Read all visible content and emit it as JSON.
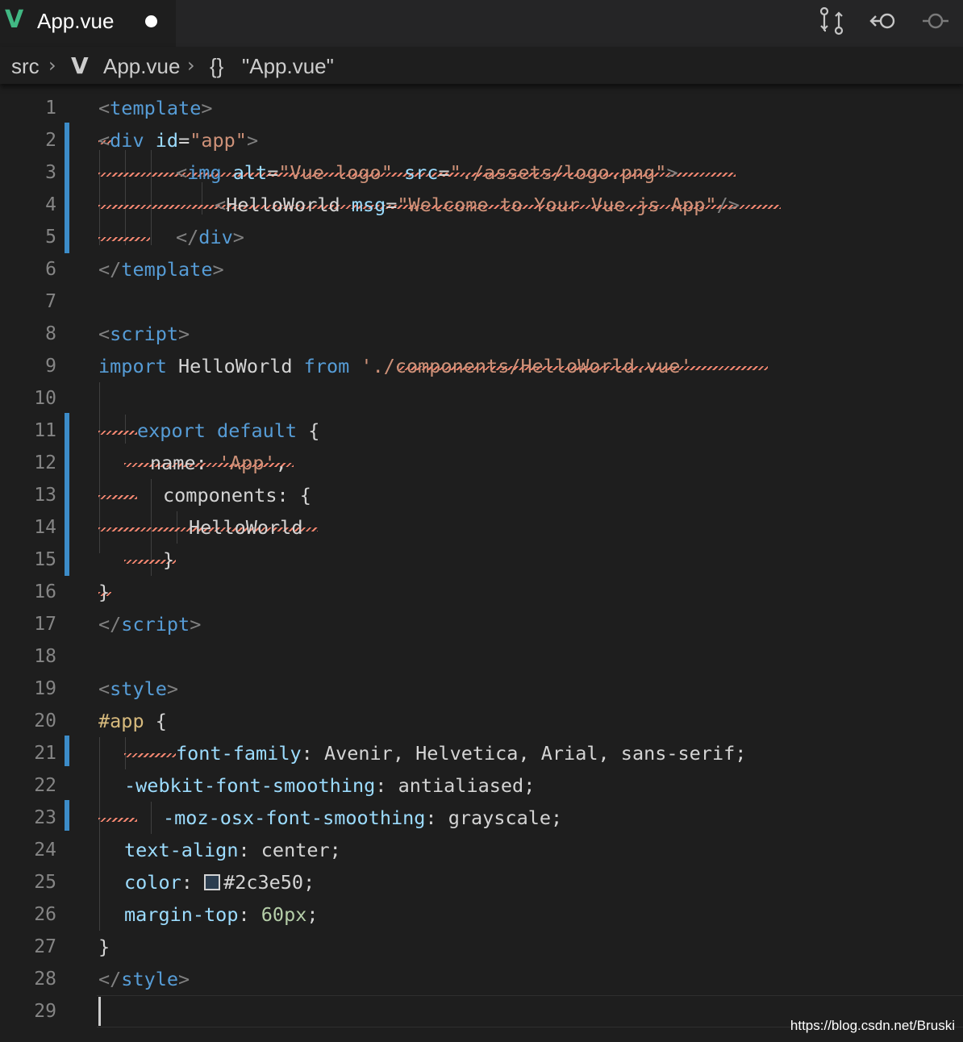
{
  "tab": {
    "filename": "App.vue",
    "vue_icon": "vue-logo-icon"
  },
  "actions": [
    {
      "name": "open-changes-icon",
      "glyph": "⇅"
    },
    {
      "name": "go-back-icon",
      "glyph": "←"
    },
    {
      "name": "go-forward-icon",
      "glyph": "→"
    }
  ],
  "breadcrumb": {
    "folder": "src",
    "sep": "›",
    "file": "App.vue",
    "symbol_icon": "{}",
    "symbol": "\"App.vue\""
  },
  "editor": {
    "line_numbers": [
      "1",
      "2",
      "3",
      "4",
      "5",
      "6",
      "7",
      "8",
      "9",
      "10",
      "11",
      "12",
      "13",
      "14",
      "15",
      "16",
      "17",
      "18",
      "19",
      "20",
      "21",
      "22",
      "23",
      "24",
      "25",
      "26",
      "27",
      "28",
      "29"
    ],
    "lines": {
      "l1": [
        "<",
        "template",
        ">"
      ],
      "l2": [
        "<",
        "div",
        " ",
        "id",
        "=",
        "\"app\"",
        ">"
      ],
      "l3": [
        "<",
        "img",
        " ",
        "alt",
        "=",
        "\"Vue logo\"",
        " ",
        "src",
        "=",
        "\"./assets/logo.png\"",
        ">"
      ],
      "l4": [
        "<",
        "HelloWorld",
        " ",
        "msg",
        "=",
        "\"Welcome to Your Vue.js App\"",
        "/>"
      ],
      "l5": [
        "</",
        "div",
        ">"
      ],
      "l6": [
        "</",
        "template",
        ">"
      ],
      "l8": [
        "<",
        "script",
        ">"
      ],
      "l9": [
        "import",
        " HelloWorld ",
        "from",
        " ",
        "'./components/HelloWorld.vue'"
      ],
      "l11": [
        "export",
        " ",
        "default",
        " {"
      ],
      "l12": [
        "name: ",
        "'App'",
        ","
      ],
      "l13": [
        "components: {"
      ],
      "l14": [
        "HelloWorld"
      ],
      "l15": [
        "}"
      ],
      "l16": [
        "}"
      ],
      "l17": [
        "</",
        "script",
        ">"
      ],
      "l19": [
        "<",
        "style",
        ">"
      ],
      "l20": [
        "#app",
        " {"
      ],
      "l21": [
        "font-family",
        ": ",
        "Avenir, Helvetica, Arial, sans-serif;"
      ],
      "l22": [
        "-webkit-font-smoothing",
        ": ",
        "antialiased;"
      ],
      "l23": [
        "-moz-osx-font-smoothing",
        ": ",
        "grayscale;"
      ],
      "l24": [
        "text-align",
        ": ",
        "center;"
      ],
      "l25": [
        "color",
        ": ",
        "#2c3e50;"
      ],
      "l26": [
        "margin-top",
        ": ",
        "60px",
        ";"
      ],
      "l27": [
        "}"
      ],
      "l28": [
        "</",
        "style",
        ">"
      ]
    },
    "color_swatch": "#2c3e50"
  },
  "watermark": "https://blog.csdn.net/Bruski",
  "colors": {
    "accent_git": "#3c8cc8",
    "error_squiggle": "#f48771",
    "vue_green": "#41b883"
  }
}
